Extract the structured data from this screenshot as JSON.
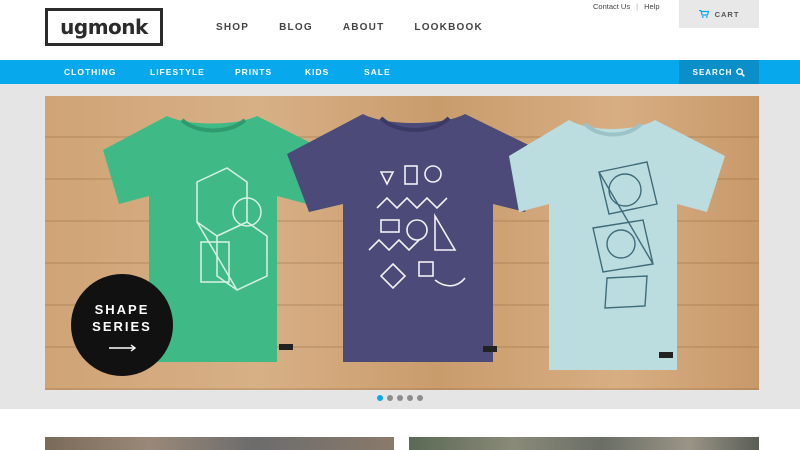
{
  "brand": {
    "logo_text": "ugmonk"
  },
  "main_nav": [
    {
      "label": "SHOP"
    },
    {
      "label": "BLOG"
    },
    {
      "label": "ABOUT"
    },
    {
      "label": "LOOKBOOK"
    }
  ],
  "utility": {
    "contact": "Contact Us",
    "help": "Help",
    "separator": "|"
  },
  "cart": {
    "label": "CART",
    "icon": "cart-icon"
  },
  "categories": [
    {
      "label": "CLOTHING"
    },
    {
      "label": "LIFESTYLE"
    },
    {
      "label": "PRINTS"
    },
    {
      "label": "KIDS"
    },
    {
      "label": "SALE"
    }
  ],
  "search": {
    "label": "SEARCH",
    "icon": "search-icon"
  },
  "hero": {
    "badge_line1": "SHAPE",
    "badge_line2": "SERIES",
    "badge_icon": "arrow-right-icon",
    "shirts": [
      {
        "name": "green shirt",
        "color": "#3fba86"
      },
      {
        "name": "navy shirt",
        "color": "#4b4a78"
      },
      {
        "name": "light blue shirt",
        "color": "#bcdde0"
      }
    ]
  },
  "carousel": {
    "slide_count": 5,
    "active_index": 0
  },
  "colors": {
    "accent": "#08a8ec",
    "accent_dark": "#0a8fc9",
    "dot_inactive": "#8c8c8c"
  }
}
